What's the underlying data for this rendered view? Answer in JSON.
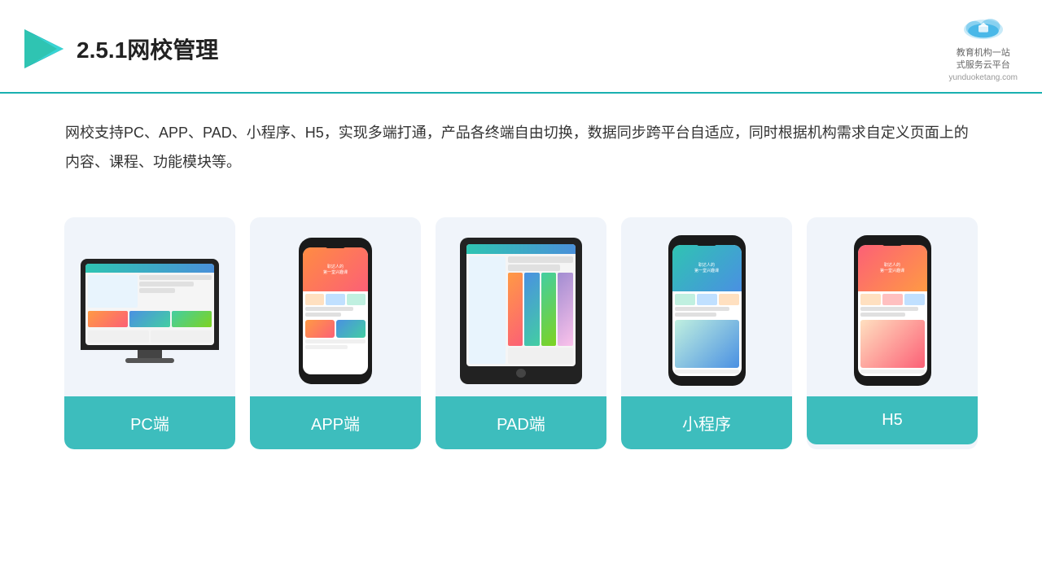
{
  "header": {
    "title": "2.5.1网校管理",
    "logo_line1": "教育机构一站",
    "logo_line2": "式服务云平台",
    "logo_url_text": "yunduoketang.com"
  },
  "description": {
    "text": "网校支持PC、APP、PAD、小程序、H5，实现多端打通，产品各终端自由切换，数据同步跨平台自适应，同时根据机构需求自定义页面上的内容、课程、功能模块等。"
  },
  "cards": [
    {
      "id": "pc",
      "label": "PC端",
      "type": "pc"
    },
    {
      "id": "app",
      "label": "APP端",
      "type": "phone"
    },
    {
      "id": "pad",
      "label": "PAD端",
      "type": "tablet"
    },
    {
      "id": "mini",
      "label": "小程序",
      "type": "phone2"
    },
    {
      "id": "h5",
      "label": "H5",
      "type": "phone3"
    }
  ],
  "brand": {
    "accent_color": "#3dbdbd",
    "teal": "#2fc4b2"
  }
}
